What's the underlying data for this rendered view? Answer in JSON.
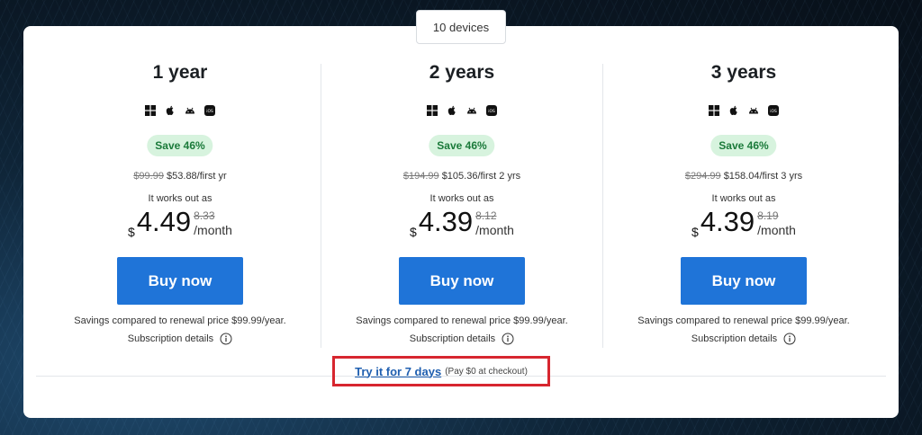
{
  "devices_tab": {
    "label": "10 devices"
  },
  "plans": [
    {
      "title": "1 year",
      "badge": "Save 46%",
      "original_price": "$99.99",
      "discount_price": "$53.88/first yr",
      "works_out_label": "It works out as",
      "currency": "$",
      "monthly_price": "4.49",
      "monthly_was": "8.33",
      "per_month": "/month",
      "buy_label": "Buy now",
      "savings_note": "Savings compared to renewal price $99.99/year.",
      "subscription_details": "Subscription details"
    },
    {
      "title": "2 years",
      "badge": "Save 46%",
      "original_price": "$194.99",
      "discount_price": "$105.36/first 2 yrs",
      "works_out_label": "It works out as",
      "currency": "$",
      "monthly_price": "4.39",
      "monthly_was": "8.12",
      "per_month": "/month",
      "buy_label": "Buy now",
      "savings_note": "Savings compared to renewal price $99.99/year.",
      "subscription_details": "Subscription details"
    },
    {
      "title": "3 years",
      "badge": "Save 46%",
      "original_price": "$294.99",
      "discount_price": "$158.04/first 3 yrs",
      "works_out_label": "It works out as",
      "currency": "$",
      "monthly_price": "4.39",
      "monthly_was": "8.19",
      "per_month": "/month",
      "buy_label": "Buy now",
      "savings_note": "Savings compared to renewal price $99.99/year.",
      "subscription_details": "Subscription details"
    }
  ],
  "os_icons": [
    "windows-icon",
    "apple-icon",
    "android-icon",
    "ios-icon"
  ],
  "trial": {
    "link_label": "Try it for 7 days",
    "note": "(Pay $0 at checkout)"
  },
  "colors": {
    "buy_button": "#1f74d8",
    "badge_bg": "#d7f3de",
    "badge_text": "#1b7a3a",
    "highlight_border": "#d7262f",
    "link": "#1f5fb0"
  }
}
